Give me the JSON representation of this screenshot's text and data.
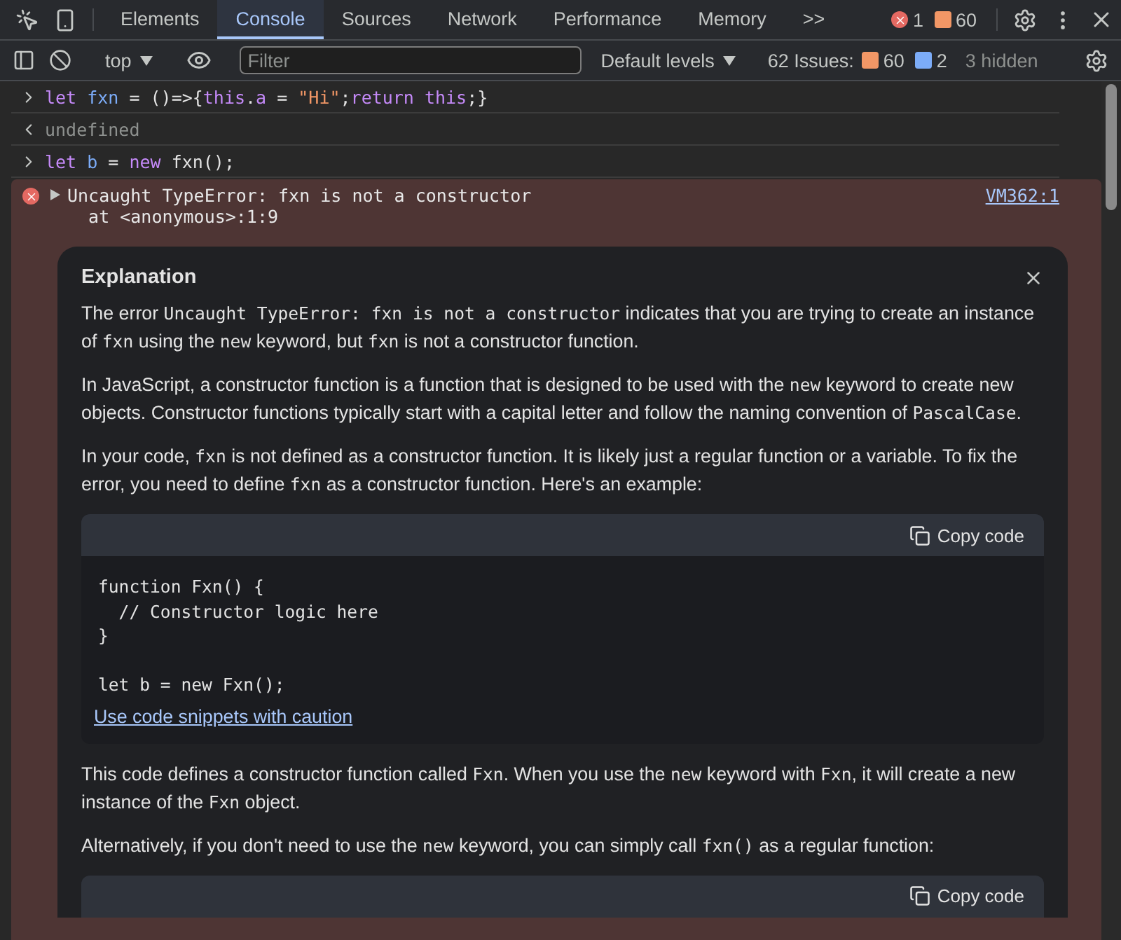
{
  "tabs": [
    {
      "label": "Elements",
      "selected": false
    },
    {
      "label": "Console",
      "selected": true
    },
    {
      "label": "Sources",
      "selected": false
    },
    {
      "label": "Network",
      "selected": false
    },
    {
      "label": "Performance",
      "selected": false
    },
    {
      "label": "Memory",
      "selected": false
    }
  ],
  "more_tabs": ">>",
  "error_count": "1",
  "warning_count": "60",
  "toolbar": {
    "context": "top",
    "filter_placeholder": "Filter",
    "levels": "Default levels",
    "issues_label": "62 Issues:",
    "issues_warnings": "60",
    "issues_info": "2",
    "hidden": "3 hidden"
  },
  "console": [
    {
      "kind": "input",
      "tokens": [
        {
          "kind": "keyword",
          "text": "let "
        },
        {
          "kind": "var",
          "text": "fxn"
        },
        {
          "kind": "plain",
          "text": " = ()=>{"
        },
        {
          "kind": "keyword",
          "text": "this"
        },
        {
          "kind": "plain",
          "text": "."
        },
        {
          "kind": "prop",
          "text": "a"
        },
        {
          "kind": "plain",
          "text": " = "
        },
        {
          "kind": "string",
          "text": "\"Hi\""
        },
        {
          "kind": "plain",
          "text": ";"
        },
        {
          "kind": "keyword",
          "text": "return this"
        },
        {
          "kind": "plain",
          "text": ";}"
        }
      ]
    },
    {
      "kind": "result",
      "tokens": [
        {
          "kind": "dim",
          "text": "undefined"
        }
      ]
    },
    {
      "kind": "input",
      "tokens": [
        {
          "kind": "keyword",
          "text": "let "
        },
        {
          "kind": "var",
          "text": "b"
        },
        {
          "kind": "plain",
          "text": " = "
        },
        {
          "kind": "keyword",
          "text": "new"
        },
        {
          "kind": "plain",
          "text": " fxn();"
        }
      ]
    }
  ],
  "error": {
    "message": "Uncaught TypeError: fxn is not a constructor",
    "stack": "at <anonymous>:1:9",
    "source": "VM362:1",
    "expanded": false
  },
  "explanation": {
    "title": "Explanation",
    "blocks": [
      {
        "kind": "paragraph",
        "segments": [
          {
            "code": false,
            "text": "The error "
          },
          {
            "code": true,
            "text": "Uncaught TypeError: fxn is not a constructor"
          },
          {
            "code": false,
            "text": " indicates that you are trying to create an instance of "
          },
          {
            "code": true,
            "text": "fxn"
          },
          {
            "code": false,
            "text": " using the "
          },
          {
            "code": true,
            "text": "new"
          },
          {
            "code": false,
            "text": " keyword, but "
          },
          {
            "code": true,
            "text": "fxn"
          },
          {
            "code": false,
            "text": " is not a constructor function."
          }
        ]
      },
      {
        "kind": "paragraph",
        "segments": [
          {
            "code": false,
            "text": "In JavaScript, a constructor function is a function that is designed to be used with the "
          },
          {
            "code": true,
            "text": "new"
          },
          {
            "code": false,
            "text": " keyword to create new objects. Constructor functions typically start with a capital letter and follow the naming convention of "
          },
          {
            "code": true,
            "text": "PascalCase"
          },
          {
            "code": false,
            "text": "."
          }
        ]
      },
      {
        "kind": "paragraph",
        "segments": [
          {
            "code": false,
            "text": "In your code, "
          },
          {
            "code": true,
            "text": "fxn"
          },
          {
            "code": false,
            "text": " is not defined as a constructor function. It is likely just a regular function or a variable. To fix the error, you need to define "
          },
          {
            "code": true,
            "text": "fxn"
          },
          {
            "code": false,
            "text": " as a constructor function. Here's an example:"
          }
        ]
      },
      {
        "kind": "code",
        "copy_label": "Copy code",
        "groups": [
          [
            "function Fxn() {",
            "  // Constructor logic here",
            "}"
          ],
          [
            "let b = new Fxn();"
          ]
        ],
        "caution_link": "Use code snippets with caution"
      },
      {
        "kind": "paragraph",
        "segments": [
          {
            "code": false,
            "text": "This code defines a constructor function called "
          },
          {
            "code": true,
            "text": "Fxn"
          },
          {
            "code": false,
            "text": ". When you use the "
          },
          {
            "code": true,
            "text": "new"
          },
          {
            "code": false,
            "text": " keyword with "
          },
          {
            "code": true,
            "text": "Fxn"
          },
          {
            "code": false,
            "text": ", it will create a new instance of the "
          },
          {
            "code": true,
            "text": "Fxn"
          },
          {
            "code": false,
            "text": " object."
          }
        ]
      },
      {
        "kind": "paragraph",
        "segments": [
          {
            "code": false,
            "text": "Alternatively, if you don't need to use the "
          },
          {
            "code": true,
            "text": "new"
          },
          {
            "code": false,
            "text": " keyword, you can simply call "
          },
          {
            "code": true,
            "text": "fxn()"
          },
          {
            "code": false,
            "text": " as a regular function:"
          }
        ]
      },
      {
        "kind": "code",
        "copy_label": "Copy code"
      }
    ]
  }
}
